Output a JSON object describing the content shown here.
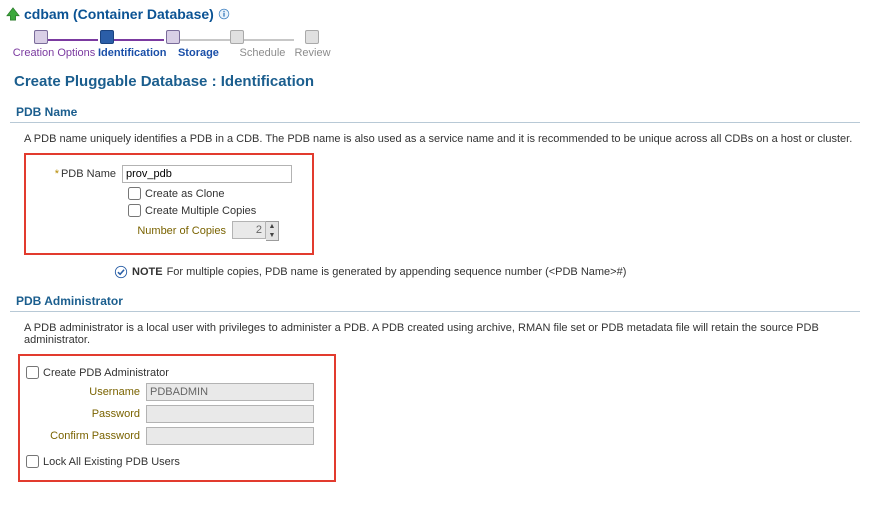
{
  "header": {
    "title": "cdbam (Container Database)"
  },
  "wizard": {
    "steps": [
      {
        "label": "Creation Options",
        "state": "done"
      },
      {
        "label": "Identification",
        "state": "current"
      },
      {
        "label": "Storage",
        "state": "done_future"
      },
      {
        "label": "Schedule",
        "state": "future"
      },
      {
        "label": "Review",
        "state": "future"
      }
    ]
  },
  "page_title": "Create Pluggable Database : Identification",
  "pdb_name_section": {
    "header": "PDB Name",
    "description": "A PDB name uniquely identifies a PDB in a CDB. The PDB name is also used as a service name and it is recommended to be unique across all CDBs on a host or cluster.",
    "pdb_name_label": "PDB Name",
    "pdb_name_value": "prov_pdb",
    "create_as_clone_label": "Create as Clone",
    "create_multiple_label": "Create Multiple Copies",
    "number_of_copies_label": "Number of Copies",
    "number_of_copies_value": "2",
    "note_label": "NOTE",
    "note_text": "For multiple copies, PDB name is generated by appending sequence number (<PDB Name>#)"
  },
  "admin_section": {
    "header": "PDB Administrator",
    "description": "A PDB administrator is a local user with privileges to administer a PDB. A PDB created using archive, RMAN file set or PDB metadata file will retain the source PDB administrator.",
    "create_admin_label": "Create PDB Administrator",
    "username_label": "Username",
    "username_value": "PDBADMIN",
    "password_label": "Password",
    "confirm_password_label": "Confirm Password",
    "lock_users_label": "Lock All Existing PDB Users"
  }
}
